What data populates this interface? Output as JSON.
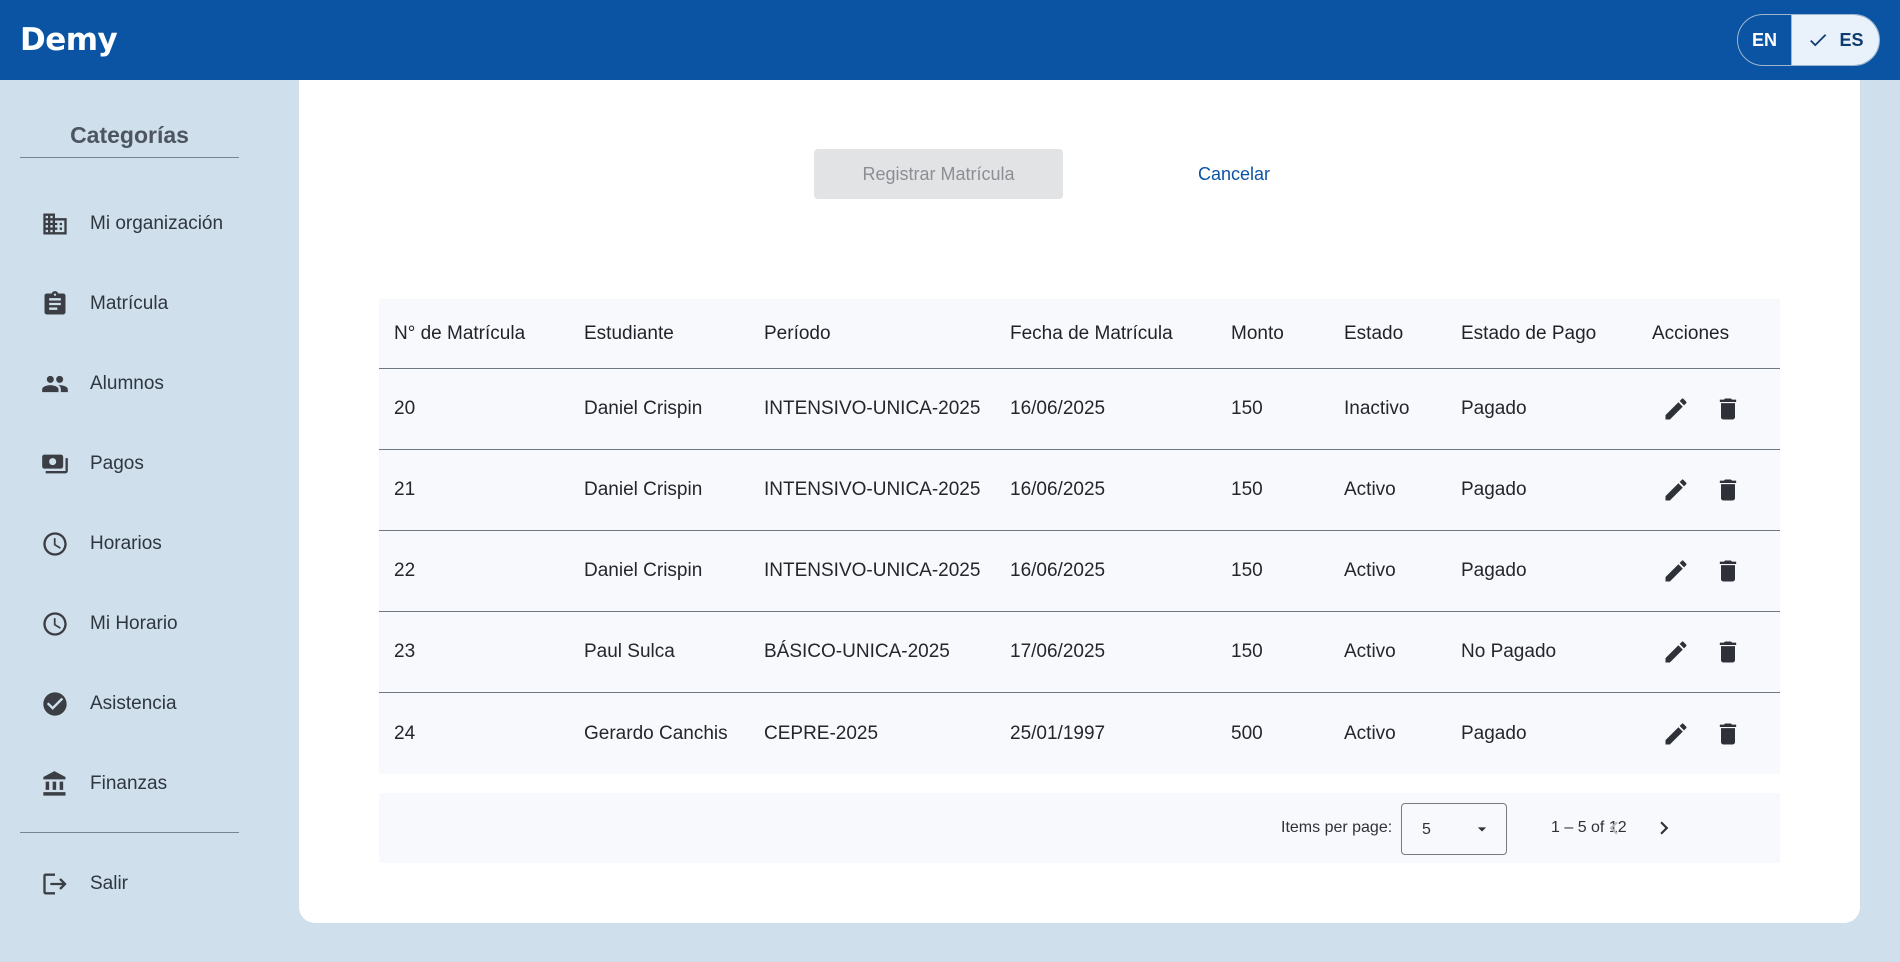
{
  "app": {
    "brand": "Demy"
  },
  "lang": {
    "en": "EN",
    "es": "ES",
    "selected": "ES"
  },
  "sidebar": {
    "title": "Categorías",
    "items": [
      {
        "label": "Mi organización",
        "icon": "building-icon"
      },
      {
        "label": "Matrícula",
        "icon": "clipboard-icon"
      },
      {
        "label": "Alumnos",
        "icon": "people-icon"
      },
      {
        "label": "Pagos",
        "icon": "payments-icon"
      },
      {
        "label": "Horarios",
        "icon": "clock-icon"
      },
      {
        "label": "Mi Horario",
        "icon": "clock-icon"
      },
      {
        "label": "Asistencia",
        "icon": "check-circle-icon"
      },
      {
        "label": "Finanzas",
        "icon": "bank-icon"
      }
    ],
    "logout": {
      "label": "Salir",
      "icon": "logout-icon"
    }
  },
  "form": {
    "register_label": "Registrar Matrícula",
    "cancel_label": "Cancelar"
  },
  "table": {
    "headers": [
      "N° de Matrícula",
      "Estudiante",
      "Período",
      "Fecha de Matrícula",
      "Monto",
      "Estado",
      "Estado de Pago",
      "Acciones"
    ],
    "rows": [
      [
        "20",
        "Daniel Crispin",
        "INTENSIVO-UNICA-2025",
        "16/06/2025",
        "150",
        "Inactivo",
        "Pagado"
      ],
      [
        "21",
        "Daniel Crispin",
        "INTENSIVO-UNICA-2025",
        "16/06/2025",
        "150",
        "Activo",
        "Pagado"
      ],
      [
        "22",
        "Daniel Crispin",
        "INTENSIVO-UNICA-2025",
        "16/06/2025",
        "150",
        "Activo",
        "Pagado"
      ],
      [
        "23",
        "Paul Sulca",
        "BÁSICO-UNICA-2025",
        "17/06/2025",
        "150",
        "Activo",
        "No Pagado"
      ],
      [
        "24",
        "Gerardo Canchis",
        "CEPRE-2025",
        "25/01/1997",
        "500",
        "Activo",
        "Pagado"
      ]
    ]
  },
  "paginator": {
    "items_label": "Items per page:",
    "page_size": "5",
    "range": "1 – 5 of 12"
  },
  "colors": {
    "header": "#0b53a3",
    "page_bg": "#cfe0ec",
    "accent": "#0b53a3"
  }
}
